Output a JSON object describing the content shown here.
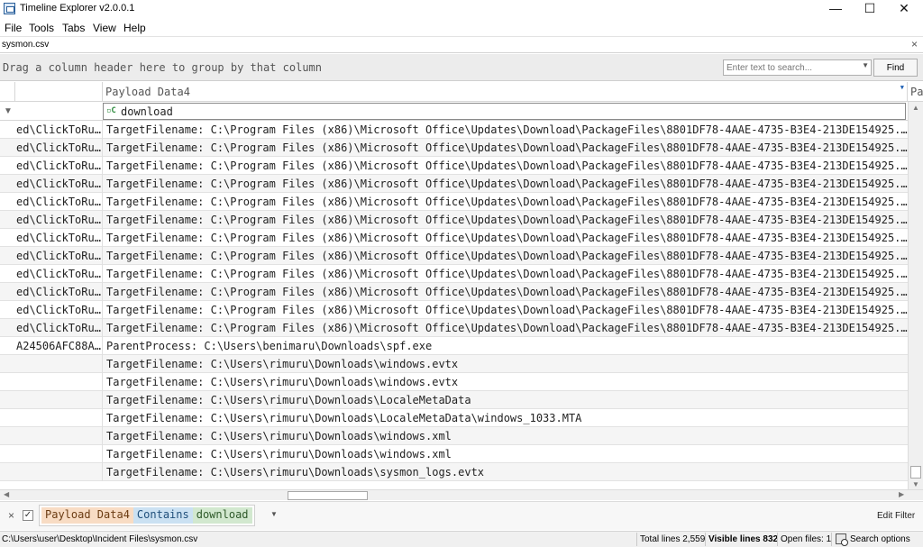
{
  "window": {
    "title": "Timeline Explorer v2.0.0.1",
    "minimize_glyph": "—",
    "maximize_glyph": "☐",
    "close_glyph": "✕"
  },
  "menu": [
    "File",
    "Tools",
    "Tabs",
    "View",
    "Help"
  ],
  "tabs": [
    {
      "label": "sysmon.csv"
    }
  ],
  "tab_close_glyph": "×",
  "group_panel": {
    "hint": "Drag a column header here to group by that column",
    "search_placeholder": "Enter text to search...",
    "find_label": "Find"
  },
  "grid": {
    "columns": [
      {
        "label": ""
      },
      {
        "label": "Payload Data4"
      },
      {
        "label": "Pa"
      }
    ],
    "filter": {
      "operator_icon": "▫C",
      "value": "download"
    },
    "rows": [
      {
        "col1": "ed\\ClickToRun...",
        "payload": "TargetFilename: C:\\Program Files (x86)\\Microsoft Office\\Updates\\Download\\PackageFiles\\8801DF78-4AAE-4735-B3E4-213DE154925..."
      },
      {
        "col1": "ed\\ClickToRun...",
        "payload": "TargetFilename: C:\\Program Files (x86)\\Microsoft Office\\Updates\\Download\\PackageFiles\\8801DF78-4AAE-4735-B3E4-213DE154925..."
      },
      {
        "col1": "ed\\ClickToRun...",
        "payload": "TargetFilename: C:\\Program Files (x86)\\Microsoft Office\\Updates\\Download\\PackageFiles\\8801DF78-4AAE-4735-B3E4-213DE154925..."
      },
      {
        "col1": "ed\\ClickToRun...",
        "payload": "TargetFilename: C:\\Program Files (x86)\\Microsoft Office\\Updates\\Download\\PackageFiles\\8801DF78-4AAE-4735-B3E4-213DE154925..."
      },
      {
        "col1": "ed\\ClickToRun...",
        "payload": "TargetFilename: C:\\Program Files (x86)\\Microsoft Office\\Updates\\Download\\PackageFiles\\8801DF78-4AAE-4735-B3E4-213DE154925..."
      },
      {
        "col1": "ed\\ClickToRun...",
        "payload": "TargetFilename: C:\\Program Files (x86)\\Microsoft Office\\Updates\\Download\\PackageFiles\\8801DF78-4AAE-4735-B3E4-213DE154925..."
      },
      {
        "col1": "ed\\ClickToRun...",
        "payload": "TargetFilename: C:\\Program Files (x86)\\Microsoft Office\\Updates\\Download\\PackageFiles\\8801DF78-4AAE-4735-B3E4-213DE154925..."
      },
      {
        "col1": "ed\\ClickToRun...",
        "payload": "TargetFilename: C:\\Program Files (x86)\\Microsoft Office\\Updates\\Download\\PackageFiles\\8801DF78-4AAE-4735-B3E4-213DE154925..."
      },
      {
        "col1": "ed\\ClickToRun...",
        "payload": "TargetFilename: C:\\Program Files (x86)\\Microsoft Office\\Updates\\Download\\PackageFiles\\8801DF78-4AAE-4735-B3E4-213DE154925..."
      },
      {
        "col1": "ed\\ClickToRun...",
        "payload": "TargetFilename: C:\\Program Files (x86)\\Microsoft Office\\Updates\\Download\\PackageFiles\\8801DF78-4AAE-4735-B3E4-213DE154925..."
      },
      {
        "col1": "ed\\ClickToRun...",
        "payload": "TargetFilename: C:\\Program Files (x86)\\Microsoft Office\\Updates\\Download\\PackageFiles\\8801DF78-4AAE-4735-B3E4-213DE154925..."
      },
      {
        "col1": "ed\\ClickToRun...",
        "payload": "TargetFilename: C:\\Program Files (x86)\\Microsoft Office\\Updates\\Download\\PackageFiles\\8801DF78-4AAE-4735-B3E4-213DE154925..."
      },
      {
        "col1": "A24506AFC88A...",
        "payload": "ParentProcess: C:\\Users\\benimaru\\Downloads\\spf.exe"
      },
      {
        "col1": "",
        "payload": "TargetFilename: C:\\Users\\rimuru\\Downloads\\windows.evtx"
      },
      {
        "col1": "",
        "payload": "TargetFilename: C:\\Users\\rimuru\\Downloads\\windows.evtx"
      },
      {
        "col1": "",
        "payload": "TargetFilename: C:\\Users\\rimuru\\Downloads\\LocaleMetaData"
      },
      {
        "col1": "",
        "payload": "TargetFilename: C:\\Users\\rimuru\\Downloads\\LocaleMetaData\\windows_1033.MTA"
      },
      {
        "col1": "",
        "payload": "TargetFilename: C:\\Users\\rimuru\\Downloads\\windows.xml"
      },
      {
        "col1": "",
        "payload": "TargetFilename: C:\\Users\\rimuru\\Downloads\\windows.xml"
      },
      {
        "col1": "",
        "payload": "TargetFilename: C:\\Users\\rimuru\\Downloads\\sysmon_logs.evtx"
      }
    ]
  },
  "filter_bar": {
    "close_glyph": "×",
    "check_glyph": "✓",
    "field": "Payload Data4",
    "operator": "Contains",
    "value": "download",
    "edit_label": "Edit Filter"
  },
  "status": {
    "path": "C:\\Users\\user\\Desktop\\Incident Files\\sysmon.csv",
    "total_lines": "Total lines 2,559",
    "visible_lines": "Visible lines 832",
    "open_files": "Open files: 1",
    "search_options": "Search options"
  },
  "colors": {
    "filter_field_bg": "#f8dcc4",
    "filter_operator_bg": "#cbe1f2",
    "filter_value_bg": "#d2e8cf",
    "header_filter_icon": "#1e5fb4"
  }
}
